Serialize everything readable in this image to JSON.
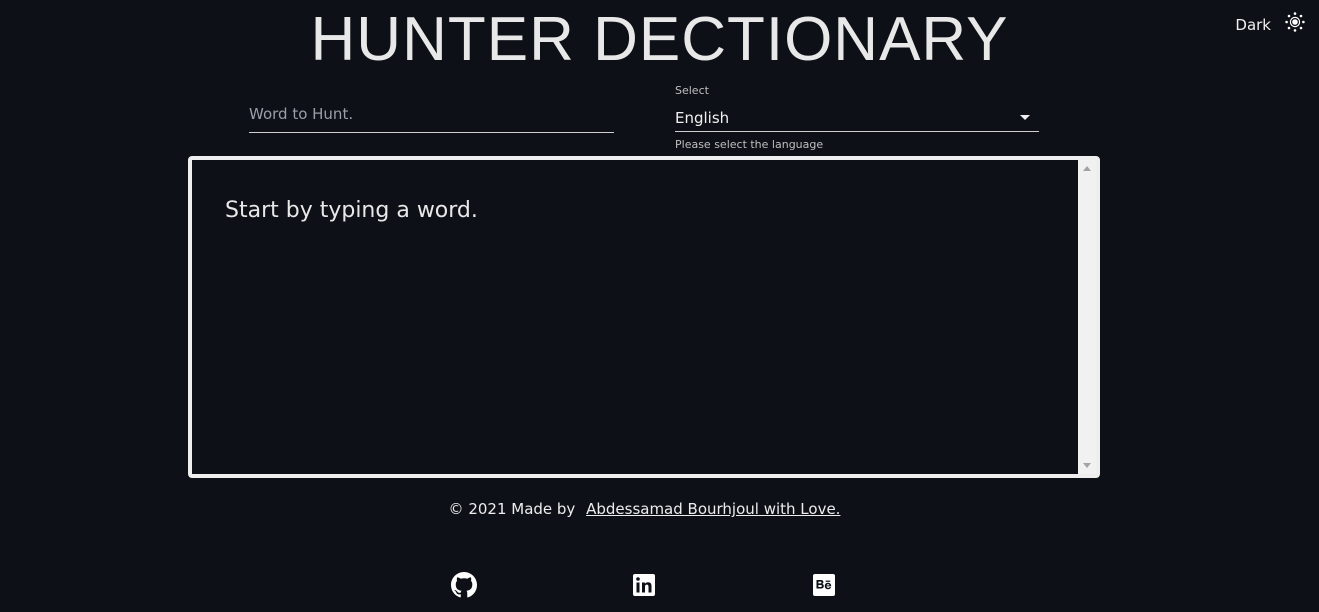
{
  "header": {
    "title": "HUNTER DECTIONARY"
  },
  "theme": {
    "label": "Dark",
    "icon": "brightness-icon"
  },
  "search": {
    "placeholder": "Word to Hunt.",
    "value": ""
  },
  "language": {
    "label": "Select",
    "selected": "English",
    "helper": "Please select the language"
  },
  "result": {
    "text": "Start by typing a word."
  },
  "footer": {
    "prefix": "© 2021 Made by",
    "author_link": "Abdessamad Bourhjoul with Love."
  },
  "social": [
    {
      "icon": "github-icon"
    },
    {
      "icon": "linkedin-icon"
    },
    {
      "icon": "behance-icon"
    }
  ],
  "colors": {
    "background": "#0d1017",
    "text": "#e6e6e6",
    "border": "#eeeeee"
  }
}
